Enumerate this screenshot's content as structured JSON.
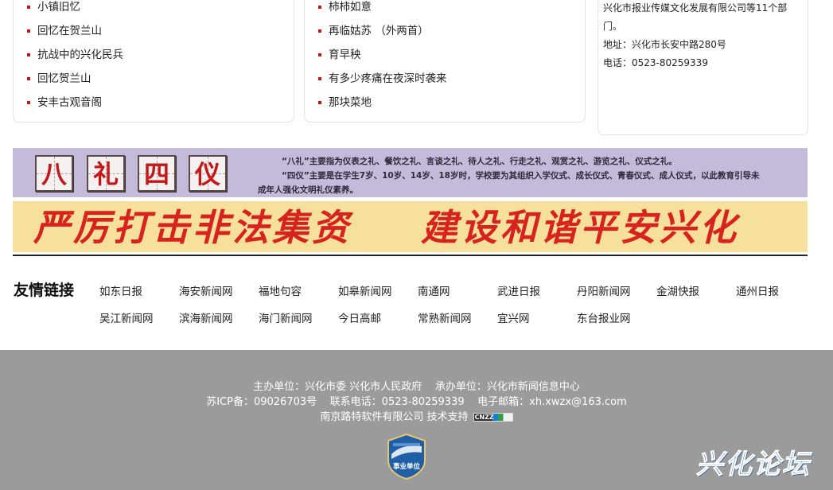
{
  "news_col1": [
    {
      "title": "小镇旧忆"
    },
    {
      "title": "回忆在贺兰山"
    },
    {
      "title": "抗战中的兴化民兵"
    },
    {
      "title": "回忆贺兰山"
    },
    {
      "title": "安丰古观音阁"
    }
  ],
  "news_col2": [
    {
      "title": "柿柿如意"
    },
    {
      "title": "再临姑苏 （外两首）"
    },
    {
      "title": "育早秧"
    },
    {
      "title": "有多少疼痛在夜深时袭来"
    },
    {
      "title": "那块菜地"
    }
  ],
  "contact": {
    "line1": "兴化市报业传媒文化发展有限公司等11个部",
    "line2": "门。",
    "address": "地址：兴化市长安中路280号",
    "phone": "电话：0523-80259339"
  },
  "banner_purple": {
    "chars": [
      "八",
      "礼",
      "四",
      "仪"
    ],
    "text1": "“八礼”主要指为仪表之礼、餐饮之礼、言谈之礼、待人之礼、行走之礼、观赏之礼、游览之礼、仪式之礼。",
    "text2": "“四仪”主要是在学生7岁、10岁、14岁、18岁时，学校要为其组织入学仪式、成长仪式、青春仪式、成人仪式，以此教育引导未",
    "text3": "成年人强化文明礼仪素养。",
    "bg_color": "#c4bad9"
  },
  "banner_orange": {
    "left": "严厉打击非法集资",
    "right": "建设和谐平安兴化",
    "bg_color": "#f7df9c",
    "text_color": "#d8221d"
  },
  "friend_links": {
    "title": "友情链接",
    "row1": [
      "如东日报",
      "海安新闻网",
      "福地句容",
      "如皋新闻网",
      "南通网",
      "武进日报",
      "丹阳新闻网",
      "金湖快报",
      "通州日报"
    ],
    "row2": [
      "吴江新闻网",
      "滨海新闻网",
      "海门新闻网",
      "今日高邮",
      "常熟新闻网",
      "宜兴网",
      "东台报业网"
    ]
  },
  "footer": {
    "line1": "主办单位：兴化市委 兴化市人民政府    承办单位：兴化市新闻信息中心",
    "line2": "苏ICP备：09026703号    联系电话：0523-80259339    电子邮箱：xh.xwzx@163.com",
    "line3": "南京路特软件有限公司 技术支持",
    "cnzz_label": "CNZZ",
    "badge_text": "事业单位",
    "forum_logo": "兴化论坛",
    "bg_color": "#9b9b9b"
  }
}
